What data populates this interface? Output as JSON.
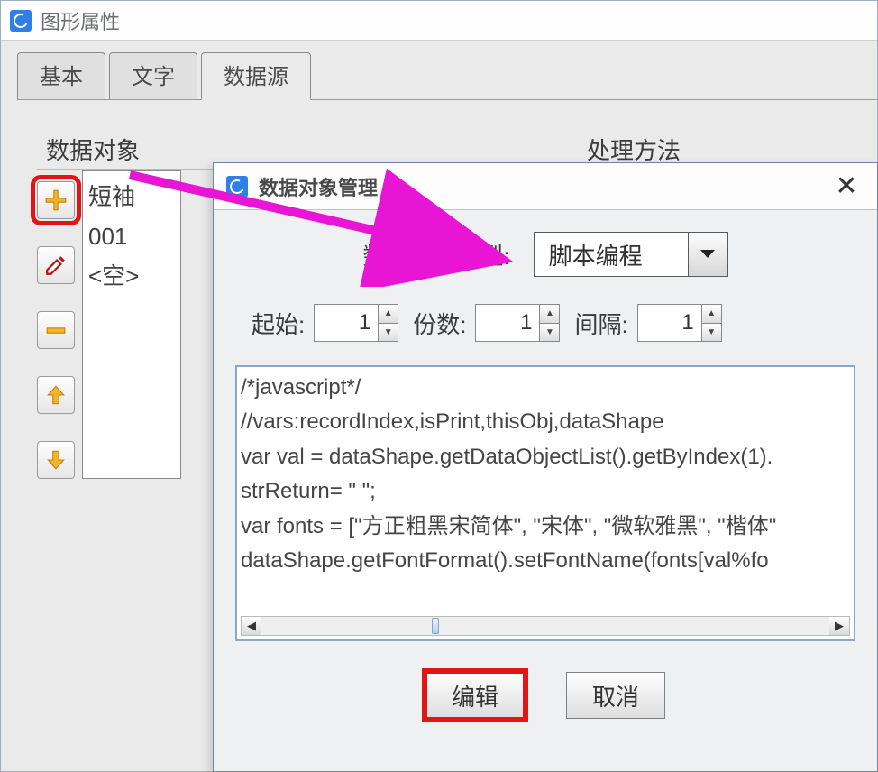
{
  "mainWindow": {
    "title": "图形属性",
    "tabs": [
      {
        "label": "基本"
      },
      {
        "label": "文字"
      },
      {
        "label": "数据源"
      }
    ],
    "groupLabels": {
      "dataObjects": "数据对象",
      "processing": "处理方法"
    },
    "objectList": [
      "短袖",
      "001",
      "<空>"
    ]
  },
  "dialog": {
    "title": "数据对象管理",
    "typeLabel": "数据对象类型:",
    "typeValue": "脚本编程",
    "startLabel": "起始:",
    "startValue": "1",
    "copiesLabel": "份数:",
    "copiesValue": "1",
    "intervalLabel": "间隔:",
    "intervalValue": "1",
    "codeText": "/*javascript*/\n//vars:recordIndex,isPrint,thisObj,dataShape\nvar val = dataShape.getDataObjectList().getByIndex(1).\nstrReturn= \" \";\nvar fonts = [\"方正粗黑宋简体\", \"宋体\", \"微软雅黑\", \"楷体\"\ndataShape.getFontFormat().setFontName(fonts[val%fo",
    "editLabel": "编辑",
    "cancelLabel": "取消"
  },
  "icons": {
    "add": "plus-icon",
    "edit": "pencil-icon",
    "remove": "minus-icon",
    "moveUp": "arrow-up-icon",
    "moveDown": "arrow-down-icon"
  },
  "colors": {
    "annotationArrow": "#e815d4",
    "highlight": "#e11515",
    "brand": "#2f7fe8"
  }
}
